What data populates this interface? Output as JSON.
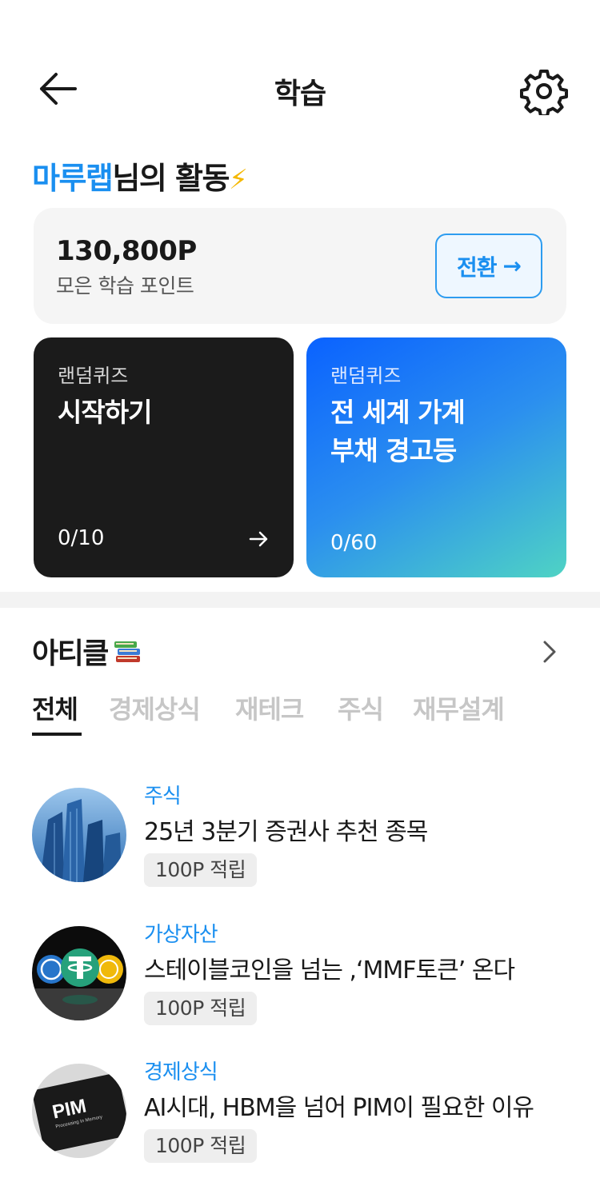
{
  "header": {
    "title": "학습"
  },
  "activity": {
    "user_name": "마루랩",
    "suffix": "님의 활동",
    "bolt": "⚡"
  },
  "points": {
    "value": "130,800P",
    "label": "모은 학습 포인트",
    "convert_label": "전환",
    "convert_arrow": "→"
  },
  "quizzes": [
    {
      "subtitle": "랜덤퀴즈",
      "title": "시작하기",
      "progress": "0/10"
    },
    {
      "subtitle": "랜덤퀴즈",
      "title_line1": "전 세계 가계",
      "title_line2": "부채 경고등",
      "progress": "0/60"
    }
  ],
  "articles_section": {
    "title": "아티클"
  },
  "tabs": [
    "전체",
    "경제상식",
    "재테크",
    "주식",
    "재무설계"
  ],
  "articles": [
    {
      "category": "주식",
      "title": "25년 3분기 증권사 추천 종목",
      "badge": "100P 적립"
    },
    {
      "category": "가상자산",
      "title": "스테이블코인을 넘는 ,‘MMF토큰’ 온다",
      "badge": "100P 적립"
    },
    {
      "category": "경제상식",
      "title": "AI시대, HBM을 넘어 PIM이 필요한 이유",
      "badge": "100P 적립"
    }
  ],
  "thumb_text": {
    "pim": "PIM",
    "pim_sub": "Processing In Memory"
  },
  "colors": {
    "accent": "#1a8ff0",
    "dark_card": "#1b1b1b",
    "gradient_start": "#0a62ff",
    "gradient_end": "#4fd3c4"
  }
}
